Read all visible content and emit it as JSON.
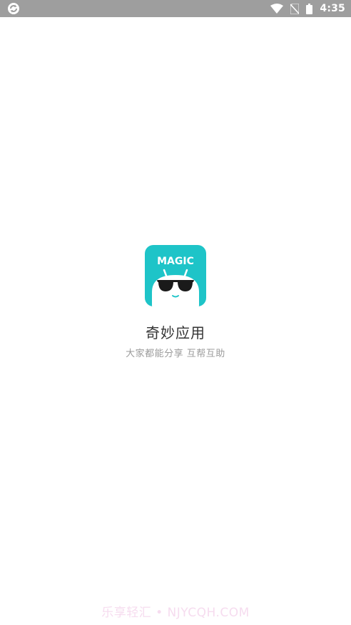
{
  "status_bar": {
    "time": "4:35",
    "icons": [
      "sync-app-icon",
      "wifi-icon",
      "no-sim-icon",
      "battery-icon"
    ]
  },
  "splash": {
    "icon_text": "MAGIC",
    "app_name": "奇妙应用",
    "tagline": "大家都能分享 互帮互助",
    "accent_color": "#1ec4c8"
  },
  "watermark": {
    "text": "乐享轻汇 • NJYCQH.COM"
  }
}
